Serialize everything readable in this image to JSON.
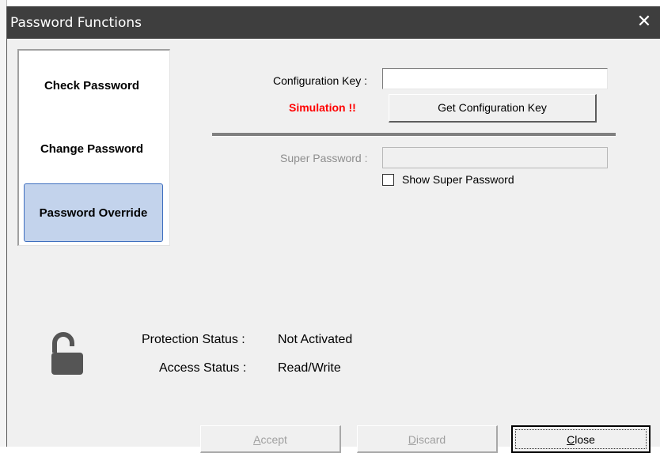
{
  "window": {
    "title": "Password Functions",
    "close_glyph": "✕"
  },
  "nav": {
    "items": [
      {
        "label": "Check Password",
        "selected": false
      },
      {
        "label": "Change Password",
        "selected": false
      },
      {
        "label": "Password Override",
        "selected": true
      }
    ]
  },
  "form": {
    "config_key_label": "Configuration Key :",
    "config_key_value": "",
    "simulation_text": "Simulation !!",
    "get_key_button": "Get Configuration Key",
    "super_password_label": "Super Password :",
    "super_password_value": "",
    "show_super_password_label": "Show Super Password",
    "show_super_password_checked": false
  },
  "status": {
    "protection_label": "Protection Status :",
    "protection_value": "Not Activated",
    "access_label": "Access Status :",
    "access_value": "Read/Write",
    "lock_icon": "unlocked-padlock-icon"
  },
  "buttons": {
    "accept": {
      "first": "A",
      "rest": "ccept"
    },
    "discard": {
      "first": "D",
      "rest": "iscard"
    },
    "close": {
      "first": "C",
      "rest": "lose"
    }
  },
  "colors": {
    "simulation": "#ff0000",
    "nav_selected_bg": "#c3d3ec",
    "nav_selected_border": "#3f6fbf",
    "titlebar": "#3e3e3e"
  }
}
